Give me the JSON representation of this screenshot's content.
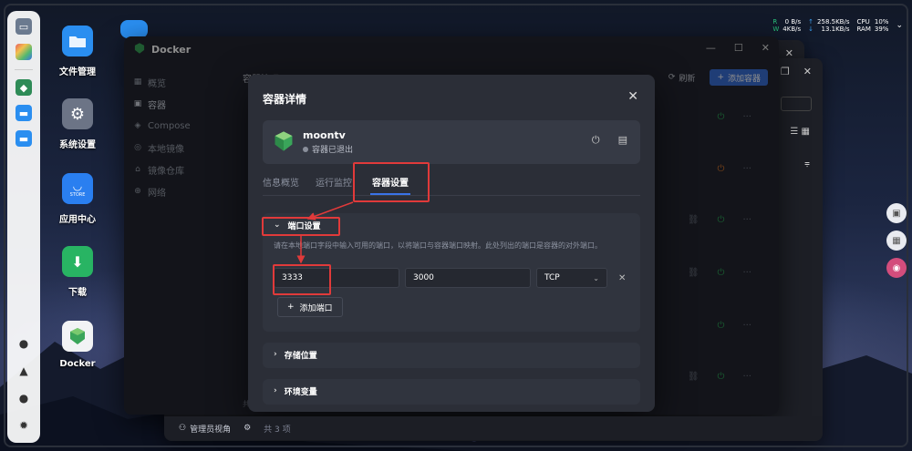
{
  "desktop": {
    "icons": [
      {
        "label": "文件管理"
      },
      {
        "label": "系统设置"
      },
      {
        "label": "应用中心",
        "sub": "STORE"
      },
      {
        "label": "下载"
      },
      {
        "label": "Docker"
      }
    ]
  },
  "status": {
    "r_label": "R",
    "w_label": "W",
    "r_val": "0  B/s",
    "w_val": "4KB/s",
    "up_val": "258.5KB/s",
    "down_val": "13.1KB/s",
    "cpu_label": "CPU",
    "cpu_val": "10%",
    "ram_label": "RAM",
    "ram_val": "39%"
  },
  "window": {
    "title": "Docker",
    "sidebar": [
      {
        "label": "概览",
        "icon": "grid-icon"
      },
      {
        "label": "容器",
        "icon": "container-icon"
      },
      {
        "label": "Compose",
        "icon": "layers-icon"
      },
      {
        "label": "本地镜像",
        "icon": "image-icon"
      },
      {
        "label": "镜像仓库",
        "icon": "warehouse-icon"
      },
      {
        "label": "网络",
        "icon": "globe-icon"
      }
    ],
    "header_label": "容器管理",
    "refresh_label": "刷新",
    "add_label": "添加容器",
    "footer_count": "共 3 项"
  },
  "modal": {
    "title": "容器详情",
    "container": {
      "name": "moontv",
      "status": "容器已退出"
    },
    "tabs": [
      "信息概览",
      "运行监控",
      "容器设置"
    ],
    "active_tab": "容器设置",
    "port_section": {
      "title": "端口设置",
      "description": "请在本地端口字段中输入可用的端口，以将端口与容器端口映射。此处列出的端口是容器的对外端口。",
      "host_port": "3333",
      "container_port": "3000",
      "protocol": "TCP",
      "add_label": "添加端口"
    },
    "storage_title": "存储位置",
    "env_title": "环境变量"
  },
  "bottom_bar": {
    "user_label": "管理员视角",
    "count": "共 3 项"
  },
  "colors": {
    "accent": "#3a73e8",
    "highlight": "#e13a3a",
    "running": "#2ea85a",
    "stopped": "#d9772b"
  }
}
